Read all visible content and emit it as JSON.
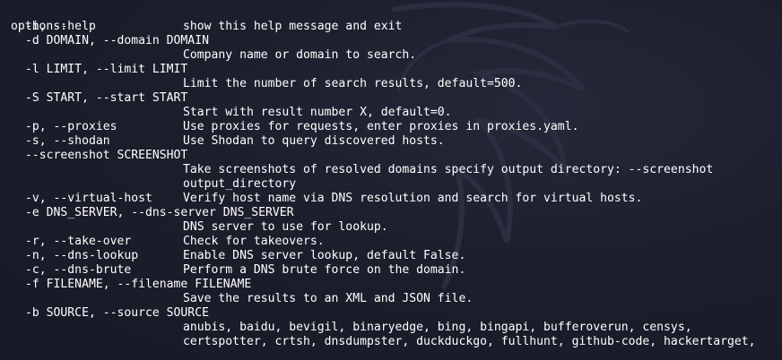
{
  "terminal": {
    "header": "options:",
    "lines": [
      {
        "opt": "-h, --help",
        "desc": "show this help message and exit"
      },
      {
        "opt": "-d DOMAIN, --domain DOMAIN",
        "desc": ""
      },
      {
        "opt": "",
        "desc": "Company name or domain to search."
      },
      {
        "opt": "-l LIMIT, --limit LIMIT",
        "desc": ""
      },
      {
        "opt": "",
        "desc": "Limit the number of search results, default=500."
      },
      {
        "opt": "-S START, --start START",
        "desc": ""
      },
      {
        "opt": "",
        "desc": "Start with result number X, default=0."
      },
      {
        "opt": "-p, --proxies",
        "desc": "Use proxies for requests, enter proxies in proxies.yaml."
      },
      {
        "opt": "-s, --shodan",
        "desc": "Use Shodan to query discovered hosts."
      },
      {
        "opt": "--screenshot SCREENSHOT",
        "desc": ""
      },
      {
        "opt": "",
        "desc": "Take screenshots of resolved domains specify output directory: --screenshot"
      },
      {
        "opt": "",
        "desc": "output_directory"
      },
      {
        "opt": "-v, --virtual-host",
        "desc": "Verify host name via DNS resolution and search for virtual hosts."
      },
      {
        "opt": "-e DNS_SERVER, --dns-server DNS_SERVER",
        "desc": ""
      },
      {
        "opt": "",
        "desc": "DNS server to use for lookup."
      },
      {
        "opt": "-r, --take-over",
        "desc": "Check for takeovers."
      },
      {
        "opt": "-n, --dns-lookup",
        "desc": "Enable DNS server lookup, default False."
      },
      {
        "opt": "-c, --dns-brute",
        "desc": "Perform a DNS brute force on the domain."
      },
      {
        "opt": "-f FILENAME, --filename FILENAME",
        "desc": ""
      },
      {
        "opt": "",
        "desc": "Save the results to an XML and JSON file."
      },
      {
        "opt": "-b SOURCE, --source SOURCE",
        "desc": ""
      },
      {
        "opt": "",
        "desc": "anubis, baidu, bevigil, binaryedge, bing, bingapi, bufferoverun, censys,"
      },
      {
        "opt": "",
        "desc": "certspotter, crtsh, dnsdumpster, duckduckgo, fullhunt, github-code, hackertarget,"
      }
    ]
  },
  "colors": {
    "background": "#1c1e2c",
    "text": "#ffffff"
  },
  "icons": {
    "watermark": "kali-dragon-icon"
  }
}
